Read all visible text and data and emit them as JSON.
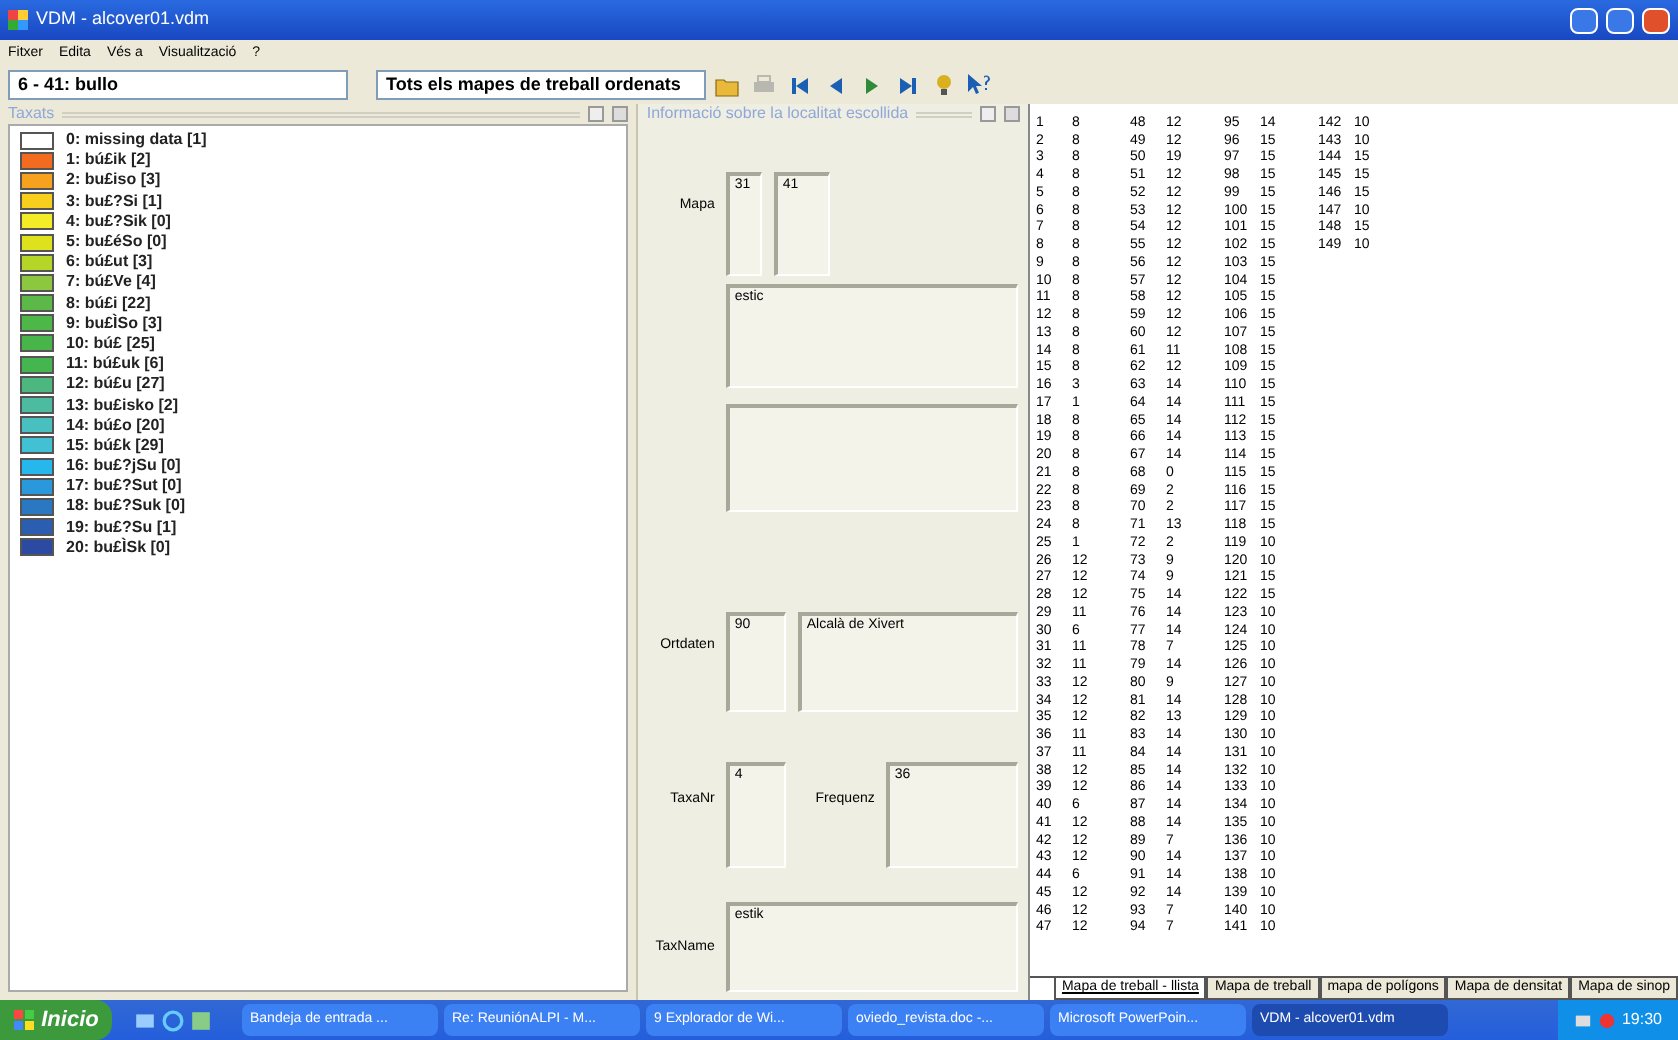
{
  "window": {
    "title": "VDM - alcover01.vdm"
  },
  "menu": [
    "Fitxer",
    "Edita",
    "Vés a",
    "Visualització",
    "?"
  ],
  "toolbar": {
    "map_select": "6 - 41: bullo",
    "view_select": "Tots els mapes de treball ordenats",
    "tools": [
      {
        "kind": "open",
        "disabled": false
      },
      {
        "kind": "print",
        "disabled": true
      },
      {
        "kind": "first",
        "disabled": false
      },
      {
        "kind": "prev",
        "disabled": false
      },
      {
        "kind": "next",
        "disabled": false
      },
      {
        "kind": "last",
        "disabled": false
      },
      {
        "kind": "bulb",
        "disabled": false
      },
      {
        "kind": "whatsthis",
        "disabled": false
      }
    ]
  },
  "legend": {
    "title": "Taxats",
    "items": [
      {
        "label": "0: missing data [1]",
        "color": "#ffffff"
      },
      {
        "label": "1: bú£ik [2]",
        "color": "#f26b1f"
      },
      {
        "label": "2: bu£iso [3]",
        "color": "#f7a21e"
      },
      {
        "label": "3: bu£?Si [1]",
        "color": "#f8cf1c"
      },
      {
        "label": "4: bu£?Sik [0]",
        "color": "#f4ec27"
      },
      {
        "label": "5: bu£éSo [0]",
        "color": "#dde21c"
      },
      {
        "label": "6: bú£ut [3]",
        "color": "#b5d626"
      },
      {
        "label": "7: bú£Ve [4]",
        "color": "#8dc63f"
      },
      {
        "label": "8: bú£i [22]",
        "color": "#5cb947"
      },
      {
        "label": "9: bu£ÌSo [3]",
        "color": "#4db848"
      },
      {
        "label": "10: bú£ [25]",
        "color": "#48b54a"
      },
      {
        "label": "11: bú£uk [6]",
        "color": "#45b550"
      },
      {
        "label": "12: bú£u [27]",
        "color": "#4cb880"
      },
      {
        "label": "13: bu£isko [2]",
        "color": "#4dbba0"
      },
      {
        "label": "14: bú£o [20]",
        "color": "#4abfbf"
      },
      {
        "label": "15: bú£k [29]",
        "color": "#43c1d4"
      },
      {
        "label": "16: bu£?jSu [0]",
        "color": "#26b7ec"
      },
      {
        "label": "17: bu£?Sut [0]",
        "color": "#2a99dc"
      },
      {
        "label": "18: bu£?Suk [0]",
        "color": "#2b78c2"
      },
      {
        "label": "19: bu£?Su [1]",
        "color": "#2b5db0"
      },
      {
        "label": "20: bu£ÌSk [0]",
        "color": "#2c4aa2"
      }
    ]
  },
  "info": {
    "title": "Informació sobre la localitat escollida",
    "map_label": "Mapa",
    "map_values": [
      "31",
      "41"
    ],
    "word": "estic",
    "place_label": "Ortdaten",
    "place_number": "90",
    "place_name": "Alcalà de Xivert",
    "taxa_label": "TaxaNr",
    "taxa_value": "4",
    "freq_label": "Frequenz",
    "freq_value": "36",
    "taxname_label": "TaxName",
    "taxname_value": "estik"
  },
  "list_columns": [
    [
      {
        "index": "1",
        "value": "8"
      },
      {
        "index": "2",
        "value": "8"
      },
      {
        "index": "3",
        "value": "8"
      },
      {
        "index": "4",
        "value": "8"
      },
      {
        "index": "5",
        "value": "8"
      },
      {
        "index": "6",
        "value": "8"
      },
      {
        "index": "7",
        "value": "8"
      },
      {
        "index": "8",
        "value": "8"
      },
      {
        "index": "9",
        "value": "8"
      },
      {
        "index": "10",
        "value": "8"
      },
      {
        "index": "11",
        "value": "8"
      },
      {
        "index": "12",
        "value": "8"
      },
      {
        "index": "13",
        "value": "8"
      },
      {
        "index": "14",
        "value": "8"
      },
      {
        "index": "15",
        "value": "8"
      },
      {
        "index": "16",
        "value": "3"
      },
      {
        "index": "17",
        "value": "1"
      },
      {
        "index": "18",
        "value": "8"
      },
      {
        "index": "19",
        "value": "8"
      },
      {
        "index": "20",
        "value": "8"
      },
      {
        "index": "21",
        "value": "8"
      },
      {
        "index": "22",
        "value": "8"
      },
      {
        "index": "23",
        "value": "8"
      },
      {
        "index": "24",
        "value": "8"
      },
      {
        "index": "25",
        "value": "1"
      },
      {
        "index": "26",
        "value": "12"
      },
      {
        "index": "27",
        "value": "12"
      },
      {
        "index": "28",
        "value": "12"
      },
      {
        "index": "29",
        "value": "11"
      },
      {
        "index": "30",
        "value": "6"
      },
      {
        "index": "31",
        "value": "11"
      },
      {
        "index": "32",
        "value": "11"
      },
      {
        "index": "33",
        "value": "12"
      },
      {
        "index": "34",
        "value": "12"
      },
      {
        "index": "35",
        "value": "12"
      },
      {
        "index": "36",
        "value": "11"
      },
      {
        "index": "37",
        "value": "11"
      },
      {
        "index": "38",
        "value": "12"
      },
      {
        "index": "39",
        "value": "12"
      },
      {
        "index": "40",
        "value": "6"
      },
      {
        "index": "41",
        "value": "12"
      },
      {
        "index": "42",
        "value": "12"
      },
      {
        "index": "43",
        "value": "12"
      },
      {
        "index": "44",
        "value": "6"
      },
      {
        "index": "45",
        "value": "12"
      },
      {
        "index": "46",
        "value": "12"
      },
      {
        "index": "47",
        "value": "12"
      }
    ],
    [
      {
        "index": "48",
        "value": "12"
      },
      {
        "index": "49",
        "value": "12"
      },
      {
        "index": "50",
        "value": "19"
      },
      {
        "index": "51",
        "value": "12"
      },
      {
        "index": "52",
        "value": "12"
      },
      {
        "index": "53",
        "value": "12"
      },
      {
        "index": "54",
        "value": "12"
      },
      {
        "index": "55",
        "value": "12"
      },
      {
        "index": "56",
        "value": "12"
      },
      {
        "index": "57",
        "value": "12"
      },
      {
        "index": "58",
        "value": "12"
      },
      {
        "index": "59",
        "value": "12"
      },
      {
        "index": "60",
        "value": "12"
      },
      {
        "index": "61",
        "value": "11"
      },
      {
        "index": "62",
        "value": "12"
      },
      {
        "index": "63",
        "value": "14"
      },
      {
        "index": "64",
        "value": "14"
      },
      {
        "index": "65",
        "value": "14"
      },
      {
        "index": "66",
        "value": "14"
      },
      {
        "index": "67",
        "value": "14"
      },
      {
        "index": "68",
        "value": "0"
      },
      {
        "index": "69",
        "value": "2"
      },
      {
        "index": "70",
        "value": "2"
      },
      {
        "index": "71",
        "value": "13"
      },
      {
        "index": "72",
        "value": "2"
      },
      {
        "index": "73",
        "value": "9"
      },
      {
        "index": "74",
        "value": "9"
      },
      {
        "index": "75",
        "value": "14"
      },
      {
        "index": "76",
        "value": "14"
      },
      {
        "index": "77",
        "value": "14"
      },
      {
        "index": "78",
        "value": "7"
      },
      {
        "index": "79",
        "value": "14"
      },
      {
        "index": "80",
        "value": "9"
      },
      {
        "index": "81",
        "value": "14"
      },
      {
        "index": "82",
        "value": "13"
      },
      {
        "index": "83",
        "value": "14"
      },
      {
        "index": "84",
        "value": "14"
      },
      {
        "index": "85",
        "value": "14"
      },
      {
        "index": "86",
        "value": "14"
      },
      {
        "index": "87",
        "value": "14"
      },
      {
        "index": "88",
        "value": "14"
      },
      {
        "index": "89",
        "value": "7"
      },
      {
        "index": "90",
        "value": "14"
      },
      {
        "index": "91",
        "value": "14"
      },
      {
        "index": "92",
        "value": "14"
      },
      {
        "index": "93",
        "value": "7"
      },
      {
        "index": "94",
        "value": "7"
      }
    ],
    [
      {
        "index": "95",
        "value": "14"
      },
      {
        "index": "96",
        "value": "15"
      },
      {
        "index": "97",
        "value": "15"
      },
      {
        "index": "98",
        "value": "15"
      },
      {
        "index": "99",
        "value": "15"
      },
      {
        "index": "100",
        "value": "15"
      },
      {
        "index": "101",
        "value": "15"
      },
      {
        "index": "102",
        "value": "15"
      },
      {
        "index": "103",
        "value": "15"
      },
      {
        "index": "104",
        "value": "15"
      },
      {
        "index": "105",
        "value": "15"
      },
      {
        "index": "106",
        "value": "15"
      },
      {
        "index": "107",
        "value": "15"
      },
      {
        "index": "108",
        "value": "15"
      },
      {
        "index": "109",
        "value": "15"
      },
      {
        "index": "110",
        "value": "15"
      },
      {
        "index": "111",
        "value": "15"
      },
      {
        "index": "112",
        "value": "15"
      },
      {
        "index": "113",
        "value": "15"
      },
      {
        "index": "114",
        "value": "15"
      },
      {
        "index": "115",
        "value": "15"
      },
      {
        "index": "116",
        "value": "15"
      },
      {
        "index": "117",
        "value": "15"
      },
      {
        "index": "118",
        "value": "15"
      },
      {
        "index": "119",
        "value": "10"
      },
      {
        "index": "120",
        "value": "10"
      },
      {
        "index": "121",
        "value": "15"
      },
      {
        "index": "122",
        "value": "15"
      },
      {
        "index": "123",
        "value": "10"
      },
      {
        "index": "124",
        "value": "10"
      },
      {
        "index": "125",
        "value": "10"
      },
      {
        "index": "126",
        "value": "10"
      },
      {
        "index": "127",
        "value": "10"
      },
      {
        "index": "128",
        "value": "10"
      },
      {
        "index": "129",
        "value": "10"
      },
      {
        "index": "130",
        "value": "10"
      },
      {
        "index": "131",
        "value": "10"
      },
      {
        "index": "132",
        "value": "10"
      },
      {
        "index": "133",
        "value": "10"
      },
      {
        "index": "134",
        "value": "10"
      },
      {
        "index": "135",
        "value": "10"
      },
      {
        "index": "136",
        "value": "10"
      },
      {
        "index": "137",
        "value": "10"
      },
      {
        "index": "138",
        "value": "10"
      },
      {
        "index": "139",
        "value": "10"
      },
      {
        "index": "140",
        "value": "10"
      },
      {
        "index": "141",
        "value": "10"
      }
    ],
    [
      {
        "index": "142",
        "value": "10"
      },
      {
        "index": "143",
        "value": "10"
      },
      {
        "index": "144",
        "value": "15"
      },
      {
        "index": "145",
        "value": "15"
      },
      {
        "index": "146",
        "value": "15"
      },
      {
        "index": "147",
        "value": "10"
      },
      {
        "index": "148",
        "value": "15"
      },
      {
        "index": "149",
        "value": "10"
      }
    ]
  ],
  "sheet_tabs": [
    {
      "label": "Mapa de treball - llista",
      "selected": true
    },
    {
      "label": "Mapa de treball",
      "selected": false
    },
    {
      "label": "mapa de polígons",
      "selected": false
    },
    {
      "label": "Mapa de densitat",
      "selected": false
    },
    {
      "label": "Mapa de sinop",
      "selected": false
    }
  ],
  "taskbar": {
    "start": "Inicio",
    "items": [
      {
        "label": "Bandeja de entrada ...",
        "selected": false
      },
      {
        "label": "Re: ReuniónALPI - M...",
        "selected": false
      },
      {
        "label": "9 Explorador de Wi...",
        "selected": false
      },
      {
        "label": "oviedo_revista.doc -...",
        "selected": false
      },
      {
        "label": "Microsoft PowerPoin...",
        "selected": false
      },
      {
        "label": "VDM - alcover01.vdm",
        "selected": true
      }
    ],
    "clock": "19:30"
  }
}
